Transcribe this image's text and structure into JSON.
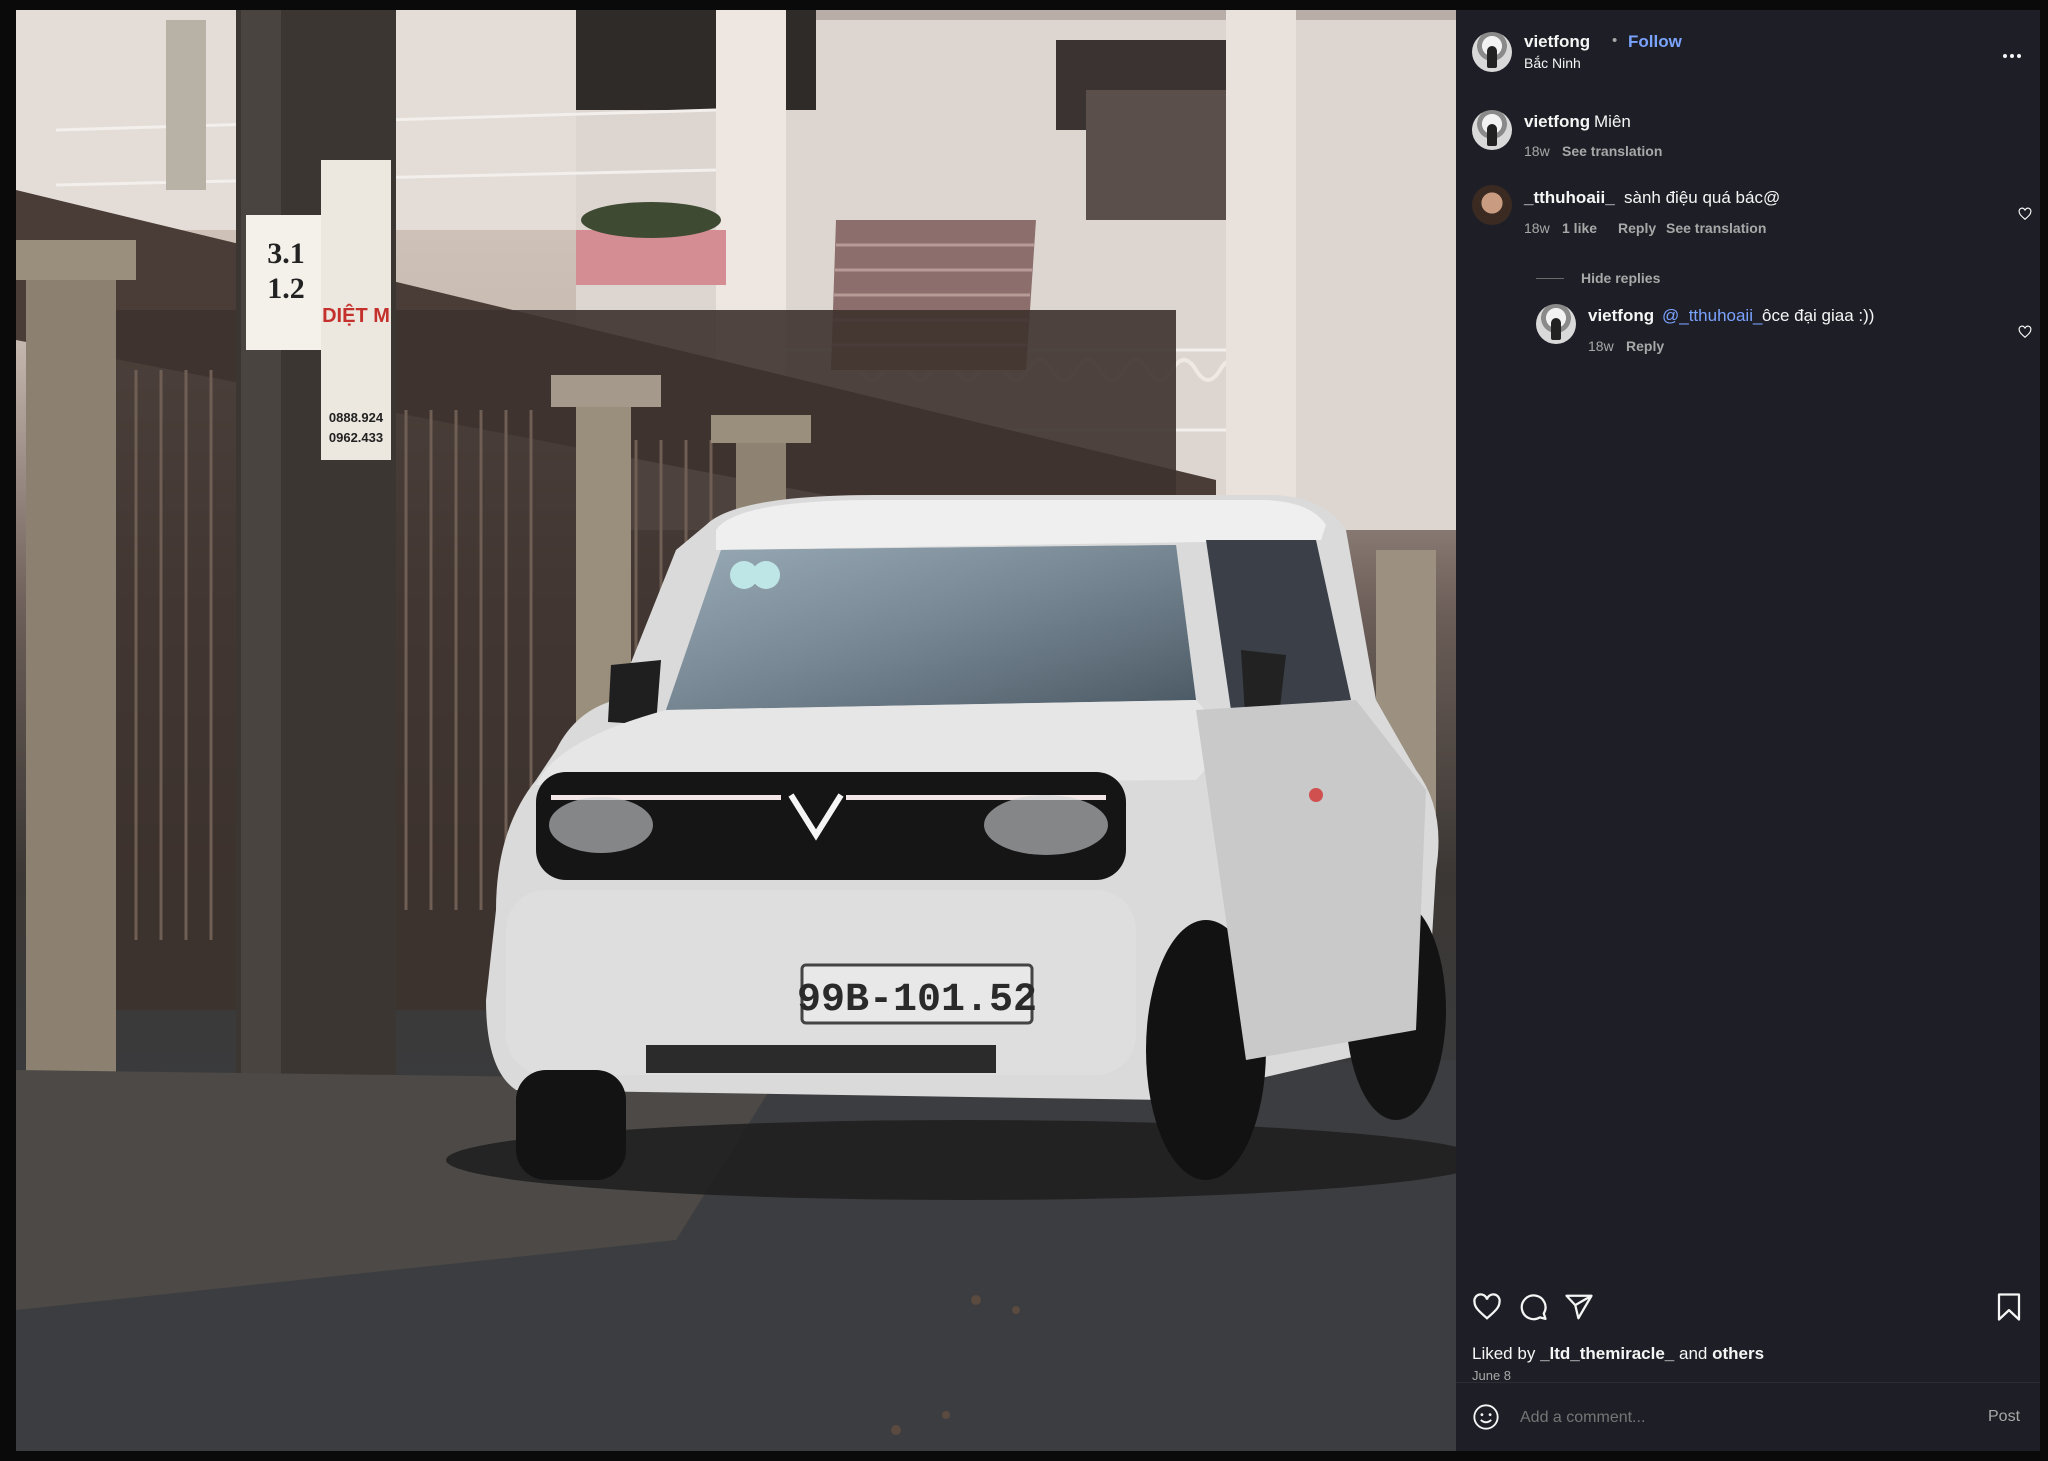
{
  "post": {
    "author": "vietfong",
    "follow_label": "Follow",
    "separator": "•",
    "location": "Bắc Ninh"
  },
  "caption": {
    "username": "vietfong",
    "text": "Miên",
    "time": "18w",
    "see_translation": "See translation"
  },
  "comments": [
    {
      "username": "_tthuhoaii_",
      "text": "sành điệu quá bác@",
      "time": "18w",
      "likes": "1 like",
      "reply_label": "Reply",
      "see_translation": "See translation"
    }
  ],
  "hide_replies_label": "Hide replies",
  "reply": {
    "username": "vietfong",
    "mention": "@_tthuhoaii_",
    "text": "ôce đại giaa :))",
    "time": "18w",
    "reply_label": "Reply"
  },
  "likes": {
    "prefix": "Liked by",
    "user": "_ltd_themiracle_",
    "connector": "and",
    "others": "others"
  },
  "date": "June 8",
  "comment_box": {
    "placeholder": "Add a comment...",
    "post_label": "Post"
  },
  "photo": {
    "plate": "99B-101.52",
    "sign_top": "3.1",
    "sign_bottom": "1.2",
    "sign_red": "DIỆT M",
    "phone1": "0888.924",
    "phone2": "0962.433"
  },
  "icons": {
    "more": "more-options-icon",
    "like": "heart-icon",
    "comment": "comment-icon",
    "share": "share-icon",
    "save": "bookmark-icon",
    "emoji": "emoji-icon"
  }
}
